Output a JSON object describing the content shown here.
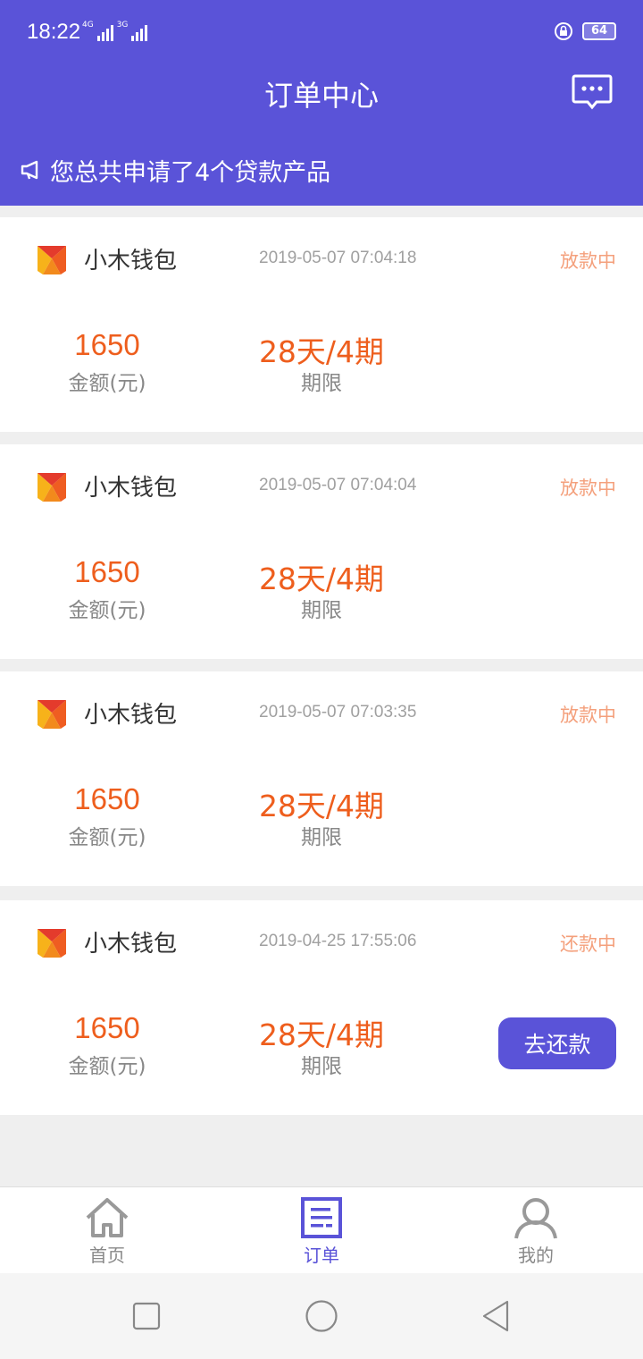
{
  "status_bar": {
    "time": "18:22",
    "network_1": "4G",
    "network_2": "3G",
    "battery": "64"
  },
  "header": {
    "title": "订单中心",
    "notice": "您总共申请了4个贷款产品",
    "icons": [
      "message-icon",
      "megaphone-icon"
    ]
  },
  "colors": {
    "primary": "#5a53d8",
    "amount": "#ee5e1d",
    "status": "#f4a07c"
  },
  "orders": [
    {
      "name": "小木钱包",
      "time": "2019-05-07 07:04:18",
      "status": "放款中",
      "amount": "1650",
      "amount_label": "金额(元)",
      "term": "28天/4期",
      "term_label": "期限"
    },
    {
      "name": "小木钱包",
      "time": "2019-05-07 07:04:04",
      "status": "放款中",
      "amount": "1650",
      "amount_label": "金额(元)",
      "term": "28天/4期",
      "term_label": "期限"
    },
    {
      "name": "小木钱包",
      "time": "2019-05-07 07:03:35",
      "status": "放款中",
      "amount": "1650",
      "amount_label": "金额(元)",
      "term": "28天/4期",
      "term_label": "期限"
    },
    {
      "name": "小木钱包",
      "time": "2019-04-25 17:55:06",
      "status": "还款中",
      "amount": "1650",
      "amount_label": "金额(元)",
      "term": "28天/4期",
      "term_label": "期限",
      "action": "去还款"
    }
  ],
  "tabbar": {
    "home": "首页",
    "orders": "订单",
    "mine": "我的",
    "active": "orders"
  }
}
